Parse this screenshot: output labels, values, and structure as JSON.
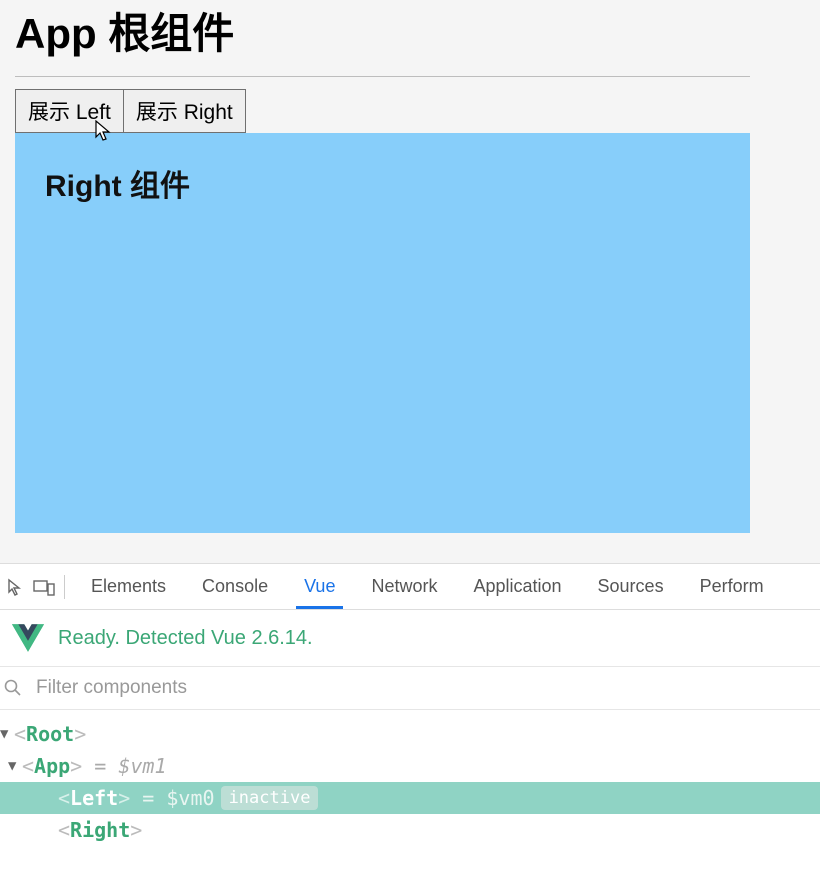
{
  "app": {
    "title": "App 根组件",
    "buttons": {
      "showLeft": "展示 Left",
      "showRight": "展示 Right"
    },
    "activeComponent": {
      "heading": "Right 组件"
    }
  },
  "devtools": {
    "tabs": {
      "elements": "Elements",
      "console": "Console",
      "vue": "Vue",
      "network": "Network",
      "application": "Application",
      "sources": "Sources",
      "perform": "Perform"
    },
    "status": "Ready. Detected Vue 2.6.14.",
    "filterPlaceholder": "Filter components",
    "tree": {
      "root": "Root",
      "app": "App",
      "appVm": " = $vm1",
      "left": "Left",
      "leftVm": " = $vm0",
      "leftInactive": "inactive",
      "right": "Right"
    }
  }
}
